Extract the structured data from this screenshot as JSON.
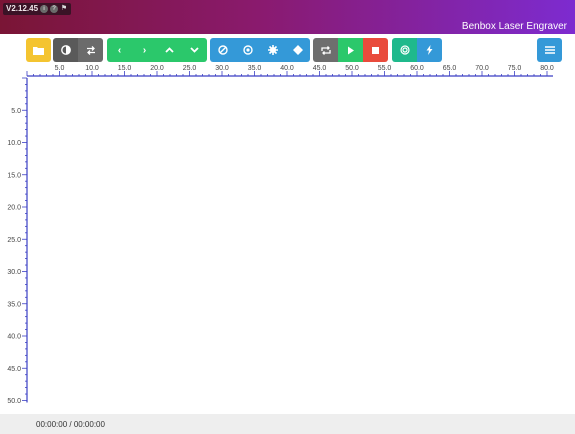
{
  "titlebar": {
    "version": "V2.12.45",
    "app_title": "Benbox Laser Engraver"
  },
  "toolbar": {
    "groups": [
      {
        "color": "#f4c430",
        "buttons": [
          "folder-icon"
        ]
      },
      {
        "color": "#5a5a5a",
        "buttons": [
          "contrast-icon",
          "swap-icon"
        ]
      },
      {
        "color": "#2bc86b",
        "buttons": [
          "chevron-left-icon",
          "chevron-right-icon",
          "chevron-up-icon",
          "chevron-down-icon"
        ]
      },
      {
        "color": "#3499d8",
        "buttons": [
          "ban-icon",
          "dot-circle-icon",
          "cog-icon",
          "move-icon"
        ]
      },
      {
        "color": "#6e6e6e",
        "buttons": [
          "repeat-icon"
        ]
      },
      {
        "color": "#2bc86b",
        "buttons": [
          "play-icon"
        ]
      },
      {
        "color": "#e94b3c",
        "buttons": [
          "stop-icon"
        ]
      },
      {
        "color": "#1fb98c",
        "buttons": [
          "target-icon"
        ]
      },
      {
        "color": "#3499d8",
        "buttons": [
          "bolt-icon"
        ]
      },
      {
        "color": "#3499d8",
        "buttons": [
          "menu-icon"
        ]
      }
    ]
  },
  "ruler_top": {
    "labels": [
      "5.0",
      "10.0",
      "15.0",
      "20.0",
      "25.0",
      "30.0",
      "35.0",
      "40.0",
      "45.0",
      "50.0",
      "55.0",
      "60.0",
      "65.0",
      "70.0",
      "75.0",
      "80.0"
    ]
  },
  "ruler_left": {
    "labels": [
      "5.0",
      "10.0",
      "15.0",
      "20.0",
      "25.0",
      "30.0",
      "35.0",
      "40.0",
      "45.0",
      "50.0"
    ]
  },
  "status": {
    "elapsed": "00:00:00",
    "separator": " / ",
    "total": "00:00:00"
  },
  "colors": {
    "title_gradient_start": "#7a1535",
    "title_gradient_end": "#7d2bd0",
    "ruler": "#3b3fc4"
  }
}
